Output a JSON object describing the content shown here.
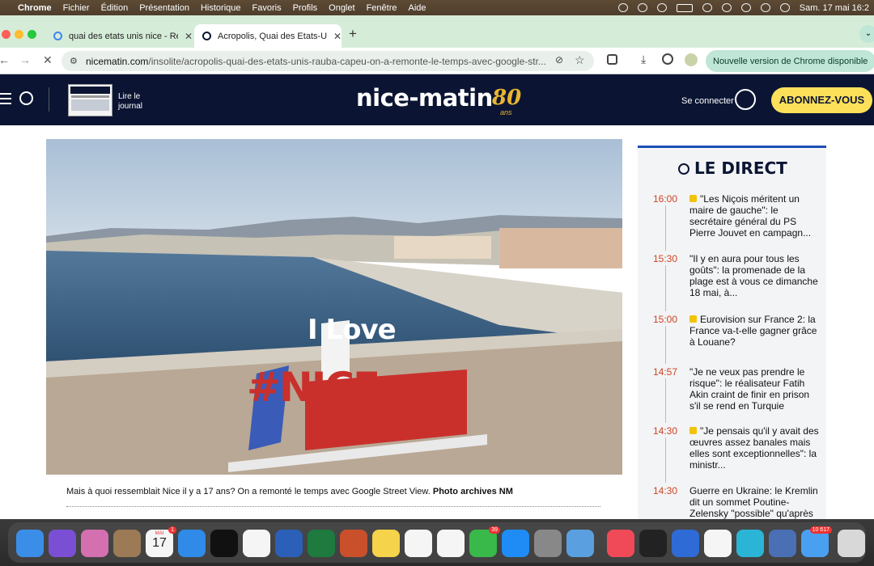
{
  "menubar": {
    "app": "Chrome",
    "items": [
      "Fichier",
      "Édition",
      "Présentation",
      "Historique",
      "Favoris",
      "Profils",
      "Onglet",
      "Fenêtre",
      "Aide"
    ],
    "clock": "Sam. 17 mai 16:2"
  },
  "tabs": [
    {
      "title": "quai des etats unis nice - Rec"
    },
    {
      "title": "Acropolis, Quai des Etats-Uni"
    }
  ],
  "address": {
    "domain": "nicematin.com",
    "path": "/insolite/acropolis-quai-des-etats-unis-rauba-capeu-on-a-remonte-le-temps-avec-google-str..."
  },
  "update_button": "Nouvelle version de Chrome disponible",
  "header": {
    "journal_label": "Lire le journal",
    "logo": "nice-matin",
    "logo_badge": "80",
    "logo_badge_sub": "ans",
    "login": "Se connecter",
    "subscribe": "ABONNEZ-VOUS"
  },
  "article": {
    "photo_text_line1": "I Love",
    "photo_text_line2": "#NICE",
    "caption": "Mais à quoi ressemblait Nice il y a 17 ans? On a remonté le temps avec Google Street View.",
    "credit": "Photo archives NM"
  },
  "direct": {
    "title": "LE DIRECT",
    "items": [
      {
        "time": "16:00",
        "text": "\"Les Niçois méritent un maire de gauche\": le secrétaire général du PS Pierre Jouvet en campagn...",
        "locked": true
      },
      {
        "time": "15:30",
        "text": "\"Il y en aura pour tous les goûts\": la promenade de la plage est à vous ce dimanche 18 mai, à...",
        "locked": false
      },
      {
        "time": "15:00",
        "text": "Eurovision sur France 2: la France va-t-elle gagner grâce à Louane?",
        "locked": true
      },
      {
        "time": "14:57",
        "text": "\"Je ne veux pas prendre le risque\": le réalisateur Fatih Akin craint de finir en prison s'il se rend en Turquie",
        "locked": false
      },
      {
        "time": "14:30",
        "text": "\"Je pensais qu'il y avait des œuvres assez banales mais elles sont exceptionnelles\": la ministr...",
        "locked": true
      },
      {
        "time": "14:30",
        "text": "Guerre en Ukraine: le Kremlin dit un sommet Poutine-Zelensky \"possible\" qu'après des \"accords\"",
        "locked": false
      }
    ]
  },
  "dock": {
    "calendar_month": "MAI",
    "calendar_day": "17",
    "calendar_badge": "1",
    "messages_badge": "39",
    "mail_badge": "10 617",
    "icons": [
      "finder-icon",
      "siri-icon",
      "launchpad-icon",
      "notes-brown-icon",
      "calendar-icon",
      "safari-icon",
      "apple-tv-icon",
      "chrome-icon",
      "word-icon",
      "excel-icon",
      "powerpoint-icon",
      "notes-icon",
      "freeform-icon",
      "photos-icon",
      "messages-icon",
      "app-store-icon",
      "iphone-mirroring-icon",
      "remote-icon",
      "music-icon",
      "terminal-icon",
      "nordvpn-icon",
      "chatgpt-icon",
      "canva-icon",
      "preview-icon",
      "mail-icon",
      "trash-icon"
    ]
  }
}
